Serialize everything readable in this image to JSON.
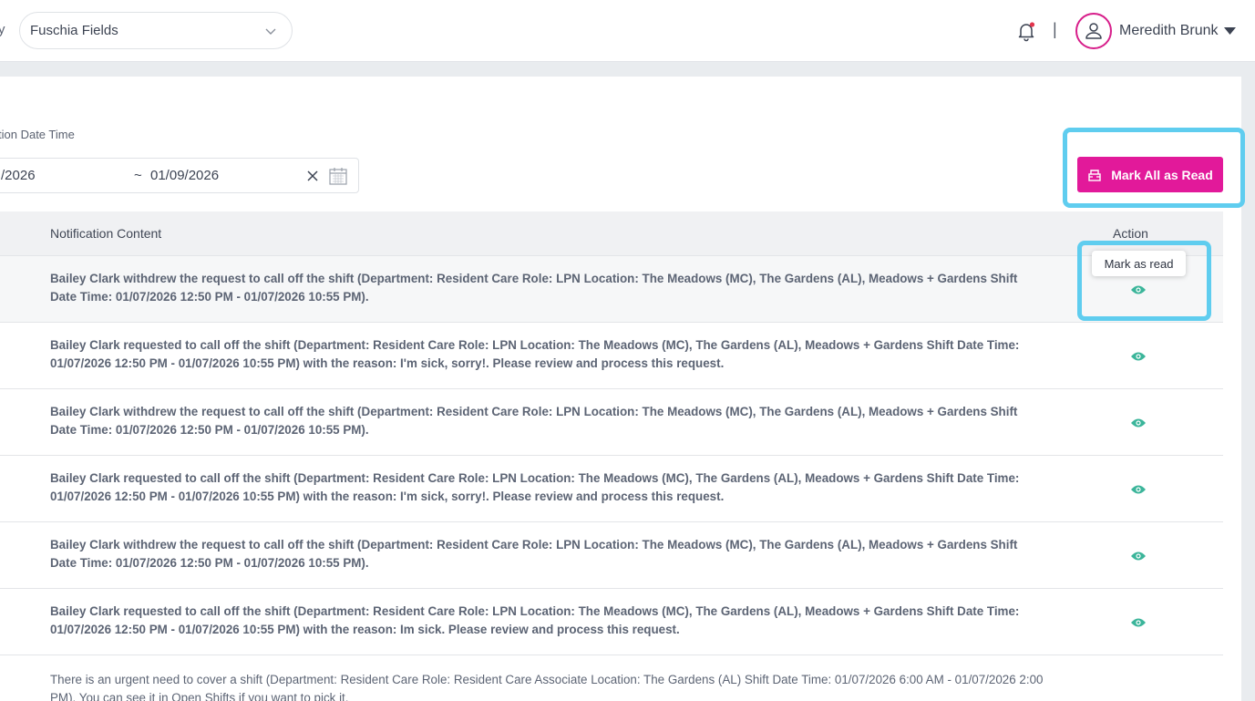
{
  "header": {
    "cut_text": "y",
    "facility": "Fuschia Fields",
    "separator": "|",
    "user_name": "Meredith Brunk"
  },
  "filter": {
    "label": "tion Date Time",
    "start_date": "/2026",
    "tilde": "~",
    "end_date": "01/09/2026"
  },
  "mark_all_label": "Mark All as Read",
  "table": {
    "col_content": "Notification Content",
    "col_action": "Action",
    "rows": [
      "Bailey Clark withdrew the request to call off the shift (Department: Resident Care Role: LPN Location: The Meadows (MC), The Gardens (AL), Meadows + Gardens Shift Date Time: 01/07/2026 12:50 PM - 01/07/2026 10:55 PM).",
      "Bailey Clark requested to call off the shift (Department: Resident Care Role: LPN Location: The Meadows (MC), The Gardens (AL), Meadows + Gardens Shift Date Time: 01/07/2026 12:50 PM - 01/07/2026 10:55 PM) with the reason: I'm sick, sorry!. Please review and process this request.",
      "Bailey Clark withdrew the request to call off the shift (Department: Resident Care Role: LPN Location: The Meadows (MC), The Gardens (AL), Meadows + Gardens Shift Date Time: 01/07/2026 12:50 PM - 01/07/2026 10:55 PM).",
      "Bailey Clark requested to call off the shift (Department: Resident Care Role: LPN Location: The Meadows (MC), The Gardens (AL), Meadows + Gardens Shift Date Time: 01/07/2026 12:50 PM - 01/07/2026 10:55 PM) with the reason: I'm sick, sorry!. Please review and process this request.",
      "Bailey Clark withdrew the request to call off the shift (Department: Resident Care Role: LPN Location: The Meadows (MC), The Gardens (AL), Meadows + Gardens Shift Date Time: 01/07/2026 12:50 PM - 01/07/2026 10:55 PM).",
      "Bailey Clark requested to call off the shift (Department: Resident Care Role: LPN Location: The Meadows (MC), The Gardens (AL), Meadows + Gardens Shift Date Time: 01/07/2026 12:50 PM - 01/07/2026 10:55 PM) with the reason: Im sick. Please review and process this request.",
      "There is an urgent need to cover a shift (Department: Resident Care Role: Resident Care Associate Location: The Gardens (AL) Shift Date Time: 01/07/2026 6:00 AM - 01/07/2026 2:00 PM). You can see it in Open Shifts if you want to pick it."
    ]
  },
  "tooltip": "Mark as read",
  "icons": {
    "bell": "bell-icon",
    "avatar": "user-icon",
    "caret": "caret-down-icon",
    "calendar": "calendar-icon",
    "clear": "close-icon",
    "eye": "eye-icon",
    "mark_all": "mark-read-icon"
  },
  "colors": {
    "accent": "#e2199a",
    "eye": "#3bb59a",
    "highlight": "#5fcdef"
  }
}
